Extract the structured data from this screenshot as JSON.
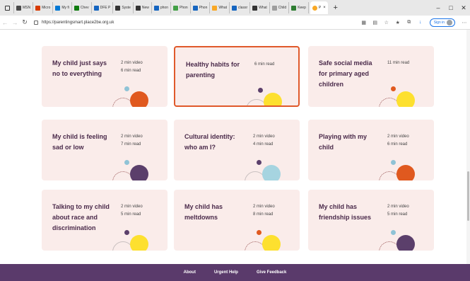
{
  "browser": {
    "tabs": [
      {
        "label": "MSN",
        "color": "#4a4a4a"
      },
      {
        "label": "Micro",
        "color": "#d83b01"
      },
      {
        "label": "My fi",
        "color": "#0078d4"
      },
      {
        "label": "Chev",
        "color": "#107c10"
      },
      {
        "label": "DFE P",
        "color": "#1565c0"
      },
      {
        "label": "Syste",
        "color": "#333333"
      },
      {
        "label": "New",
        "color": "#333333"
      },
      {
        "label": "phon",
        "color": "#1565c0"
      },
      {
        "label": "Phon",
        "color": "#43a047"
      },
      {
        "label": "Phon",
        "color": "#1565c0"
      },
      {
        "label": "What",
        "color": "#f9a825"
      },
      {
        "label": "classr",
        "color": "#1565c0"
      },
      {
        "label": "What",
        "color": "#333333"
      },
      {
        "label": "Child",
        "color": "#9e9e9e"
      },
      {
        "label": "Keep",
        "color": "#2e7d32"
      }
    ],
    "active_tab": {
      "label": "P",
      "color": "#f9a825"
    },
    "url": "https://parentingsmart.place2be.org.uk",
    "signin_label": "Sign in",
    "window_controls": [
      "–",
      "□",
      "✕"
    ],
    "new_tab": "+",
    "close_tab": "×"
  },
  "cards": [
    {
      "title": "My child just says no to everything",
      "meta": [
        "2 min video",
        "6 min read"
      ],
      "dot": "#8fc3d6",
      "circle": "#e0591f",
      "arc": "dotted",
      "highlight": false
    },
    {
      "title": "Healthy habits for parenting",
      "meta": [
        "6 min read"
      ],
      "dot": "#5b3f6b",
      "circle": "#fde02f",
      "arc": "grey",
      "highlight": true
    },
    {
      "title": "Safe social media for primary aged children",
      "meta": [
        "11 min read"
      ],
      "dot": "#e0591f",
      "circle": "#fde02f",
      "arc": "dotted",
      "highlight": false
    },
    {
      "title": "My child is feeling sad or low",
      "meta": [
        "2 min video",
        "7 min read"
      ],
      "dot": "#8fc3d6",
      "circle": "#5b3f6b",
      "arc": "dotted",
      "highlight": false
    },
    {
      "title": "Cultural identity: who am I?",
      "meta": [
        "2 min video",
        "4 min read"
      ],
      "dot": "#5b3f6b",
      "circle": "#a6d4e0",
      "arc": "grey",
      "highlight": false
    },
    {
      "title": "Playing with my child",
      "meta": [
        "2 min video",
        "6 min read"
      ],
      "dot": "#8fc3d6",
      "circle": "#e0591f",
      "arc": "dotted",
      "highlight": false
    },
    {
      "title": "Talking to my child about race and discrimination",
      "meta": [
        "2 min video",
        "5 min read"
      ],
      "dot": "#5b3f6b",
      "circle": "#fde02f",
      "arc": "grey",
      "highlight": false
    },
    {
      "title": "My child has meltdowns",
      "meta": [
        "2 min video",
        "8 min read"
      ],
      "dot": "#e0591f",
      "circle": "#fde02f",
      "arc": "dotted",
      "highlight": false
    },
    {
      "title": "My child has friendship issues",
      "meta": [
        "2 min video",
        "5 min read"
      ],
      "dot": "#8fc3d6",
      "circle": "#5b3f6b",
      "arc": "dotted",
      "highlight": false
    }
  ],
  "footer": {
    "links": [
      "About",
      "Urgent Help",
      "Give Feedback"
    ]
  }
}
